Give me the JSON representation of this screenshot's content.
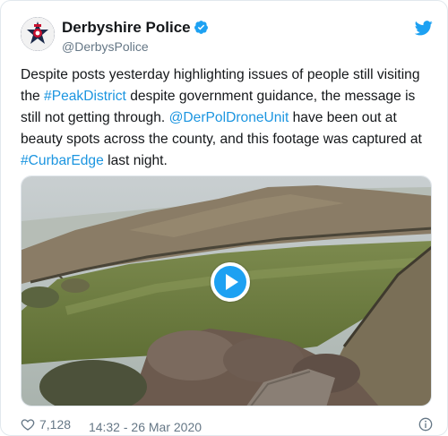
{
  "tweet": {
    "display_name": "Derbyshire Police",
    "handle": "@DerbysPolice",
    "text_parts": {
      "t1": "Despite posts yesterday highlighting issues of people still visiting the ",
      "l1": "#PeakDistrict",
      "t2": " despite government guidance, the message is still not getting through. ",
      "l2": "@DerPolDroneUnit",
      "t3": " have been out at beauty spots across the county, and this footage was captured at ",
      "l3": "#CurbarEdge",
      "t4": " last night."
    },
    "likes": "7,128",
    "timestamp": "14:32 - 26 Mar 2020"
  },
  "icons": {
    "avatar": "police-crest-icon",
    "verified": "verified-badge-icon",
    "brand": "twitter-bird-icon",
    "play": "play-icon",
    "like": "heart-icon",
    "info": "info-icon"
  },
  "colors": {
    "link": "#1b95e0",
    "brand": "#1da1f2",
    "muted": "#657786",
    "text": "#14171a"
  }
}
